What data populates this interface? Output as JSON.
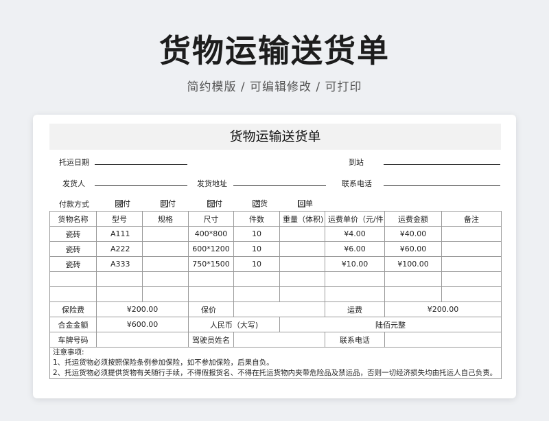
{
  "hero": {
    "title": "货物运输送货单",
    "subtitle": "简约模版 /  可编辑修改 /  可打印"
  },
  "form": {
    "title": "货物运输送货单",
    "consign_date_label": "托运日期",
    "arrival_label": "到站",
    "shipper_label": "发货人",
    "ship_address_label": "发货地址",
    "contact_phone_label": "联系电话",
    "payment_label": "付款方式",
    "payment_options": [
      {
        "label": "现付",
        "checked": true
      },
      {
        "label": "到付",
        "checked": false
      },
      {
        "label": "提付",
        "checked": false
      },
      {
        "label": "送货",
        "checked": false
      },
      {
        "label": "回单",
        "checked": false
      }
    ],
    "check_mark": "☑"
  },
  "table": {
    "headers": [
      "货物名称",
      "型号",
      "规格",
      "尺寸",
      "件数",
      "重量（体积)",
      "运费单价（元/件)",
      "运费金额",
      "备注"
    ],
    "rows": [
      [
        "瓷砖",
        "A111",
        "",
        "400*800",
        "10",
        "",
        "¥4.00",
        "¥40.00",
        ""
      ],
      [
        "瓷砖",
        "A222",
        "",
        "600*1200",
        "10",
        "",
        "¥6.00",
        "¥60.00",
        ""
      ],
      [
        "瓷砖",
        "A333",
        "",
        "750*1500",
        "10",
        "",
        "¥10.00",
        "¥100.00",
        ""
      ]
    ],
    "insurance_fee_label": "保险费",
    "insurance_fee_value": "¥200.00",
    "declared_value_label": "保价",
    "freight_label": "运费",
    "freight_value": "¥200.00",
    "total_label": "合金金额",
    "total_value": "¥600.00",
    "rmb_upper_label": "人民币（大写)",
    "rmb_upper_value": "陆佰元整",
    "plate_label": "车牌号码",
    "driver_label": "驾驶员姓名",
    "contact_phone_label": "联系电话",
    "notes_title": "注意事项:",
    "notes": [
      "1、托运货物必须按照保险条例参加保险，如不参加保险，后果自负。",
      "2、托运货物必须提供货物有关随行手续，不得假报货名、不得在托运货物内夹带危险品及禁运品，否则一切经济损失均由托运人自己负责。"
    ]
  }
}
